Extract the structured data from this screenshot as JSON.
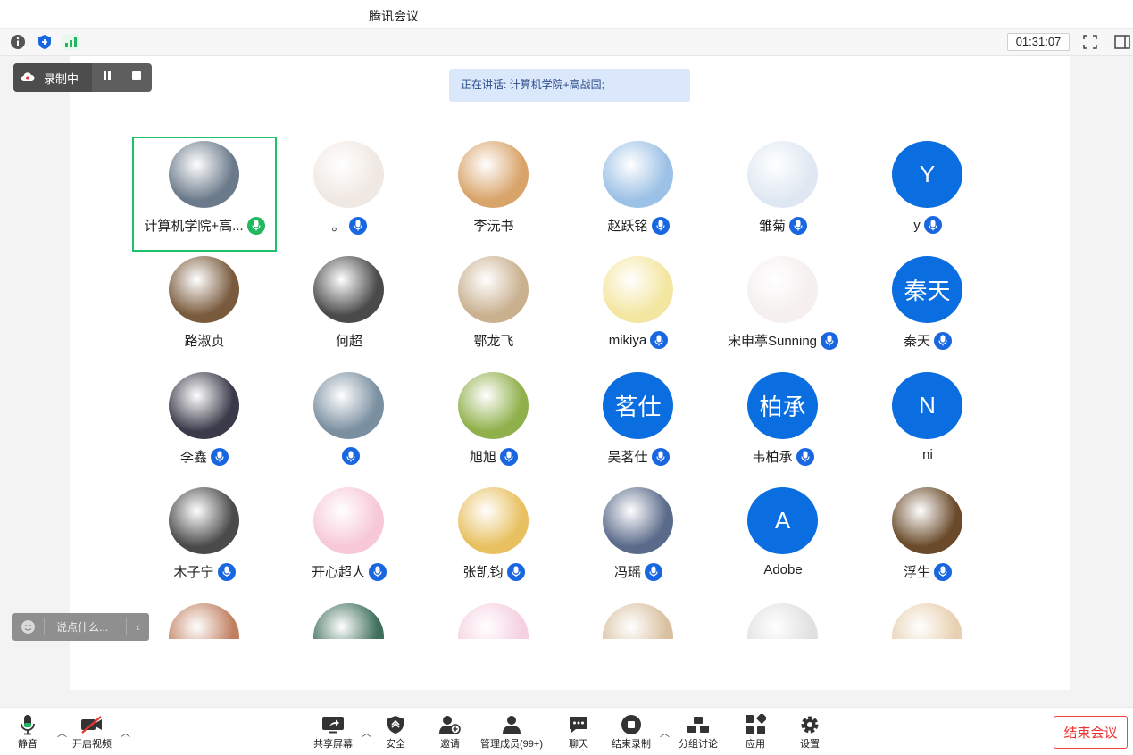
{
  "window": {
    "title": "腾讯会议"
  },
  "infobar": {
    "timer": "01:31:07"
  },
  "recording": {
    "label": "录制中"
  },
  "speaking": {
    "text": "正在讲话: 计算机学院+高战国;"
  },
  "chat": {
    "placeholder": "说点什么..."
  },
  "colors": {
    "accent": "#0a6ee0",
    "active_border": "#1fc16b",
    "end_button": "#e44444"
  },
  "participants": [
    {
      "name": "计算机学院+高...",
      "mic": "speaking",
      "avatar": "photo"
    },
    {
      "name": "。",
      "mic": "on",
      "avatar": "photo"
    },
    {
      "name": "李沅书",
      "mic": "none",
      "avatar": "photo"
    },
    {
      "name": "赵跃铭",
      "mic": "on",
      "avatar": "photo"
    },
    {
      "name": "雏菊",
      "mic": "on",
      "avatar": "photo"
    },
    {
      "name": "y",
      "mic": "on",
      "avatar": "letter",
      "letter": "Y"
    },
    {
      "name": "路淑贞",
      "mic": "none",
      "avatar": "photo"
    },
    {
      "name": "何超",
      "mic": "none",
      "avatar": "photo"
    },
    {
      "name": "鄂龙飞",
      "mic": "none",
      "avatar": "photo"
    },
    {
      "name": "mikiya",
      "mic": "on",
      "avatar": "photo"
    },
    {
      "name": "宋申葶Sunning",
      "mic": "on",
      "avatar": "photo"
    },
    {
      "name": "秦天",
      "mic": "on",
      "avatar": "letter",
      "letter": "秦天"
    },
    {
      "name": "李鑫",
      "mic": "on",
      "avatar": "photo"
    },
    {
      "name": "",
      "mic": "on",
      "avatar": "photo"
    },
    {
      "name": "旭旭",
      "mic": "on",
      "avatar": "photo"
    },
    {
      "name": "吴茗仕",
      "mic": "on",
      "avatar": "letter",
      "letter": "茗仕"
    },
    {
      "name": "韦柏承",
      "mic": "on",
      "avatar": "letter",
      "letter": "柏承"
    },
    {
      "name": "ni",
      "mic": "none",
      "avatar": "letter",
      "letter": "N"
    },
    {
      "name": "木子宁",
      "mic": "on",
      "avatar": "photo"
    },
    {
      "name": "开心超人",
      "mic": "on",
      "avatar": "photo"
    },
    {
      "name": "张凯钧",
      "mic": "on",
      "avatar": "photo"
    },
    {
      "name": "冯瑶",
      "mic": "on",
      "avatar": "photo"
    },
    {
      "name": "Adobe",
      "mic": "none",
      "avatar": "letter",
      "letter": "A"
    },
    {
      "name": "浮生",
      "mic": "on",
      "avatar": "photo"
    },
    {
      "name": "",
      "mic": "none",
      "avatar": "photo"
    },
    {
      "name": "",
      "mic": "none",
      "avatar": "photo"
    },
    {
      "name": "",
      "mic": "none",
      "avatar": "photo"
    },
    {
      "name": "",
      "mic": "none",
      "avatar": "photo"
    },
    {
      "name": "",
      "mic": "none",
      "avatar": "photo"
    },
    {
      "name": "",
      "mic": "none",
      "avatar": "photo"
    }
  ],
  "toolbar": {
    "mute": "静音",
    "video": "开启视频",
    "share": "共享屏幕",
    "security": "安全",
    "invite": "邀请",
    "members": "管理成员(99+)",
    "chat": "聊天",
    "end_record": "结束录制",
    "breakout": "分组讨论",
    "apps": "应用",
    "settings": "设置",
    "end_meeting": "结束会议"
  }
}
